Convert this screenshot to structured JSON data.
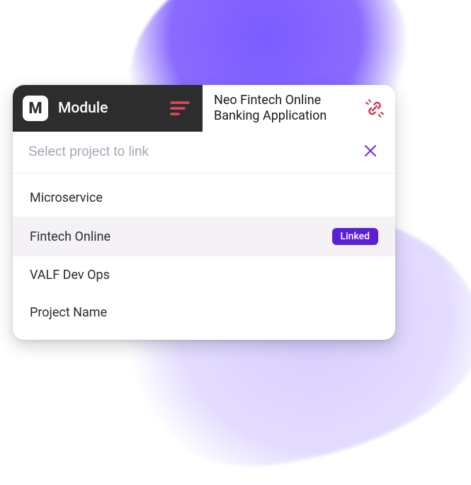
{
  "header": {
    "logo_letter": "M",
    "module_label": "Module",
    "project_title": "Neo Fintech Online Banking Application"
  },
  "search": {
    "placeholder": "Select project to link",
    "value": ""
  },
  "projects": [
    {
      "name": "Microservice",
      "linked": false,
      "highlighted": false
    },
    {
      "name": "Fintech Online",
      "linked": true,
      "highlighted": true
    },
    {
      "name": "VALF Dev Ops",
      "linked": false,
      "highlighted": false
    },
    {
      "name": "Project Name",
      "linked": false,
      "highlighted": false
    }
  ],
  "badge_label": "Linked",
  "colors": {
    "header_dark": "#2d2d2d",
    "accent_purple": "#5b1fd6",
    "sort_red": "#e24a5a",
    "link_red": "#d0304a"
  }
}
